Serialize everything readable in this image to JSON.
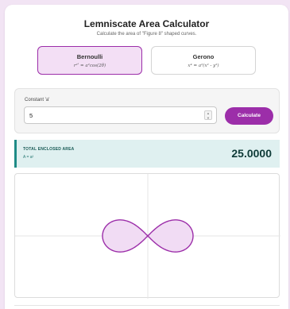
{
  "header": {
    "title": "Lemniscate Area Calculator",
    "subtitle": "Calculate the area of \"Figure 8\" shaped curves."
  },
  "curves": [
    {
      "name": "Bernoulli",
      "equation": "r²ʹ = a²cos(2θ)",
      "selected": true
    },
    {
      "name": "Gerono",
      "equation": "x⁴ = a²(x² - y²)",
      "selected": false
    }
  ],
  "parameter": {
    "label": "Constant 'a'",
    "value": "5"
  },
  "calculate_button": "Calculate",
  "result": {
    "label": "TOTAL ENCLOSED AREA",
    "formula": "A = a²",
    "value": "25.0000"
  },
  "colors": {
    "accent": "#9c2ea9",
    "accent_light": "#f3dff5",
    "result_bg": "#dff0f0",
    "result_border": "#1e8b86"
  }
}
